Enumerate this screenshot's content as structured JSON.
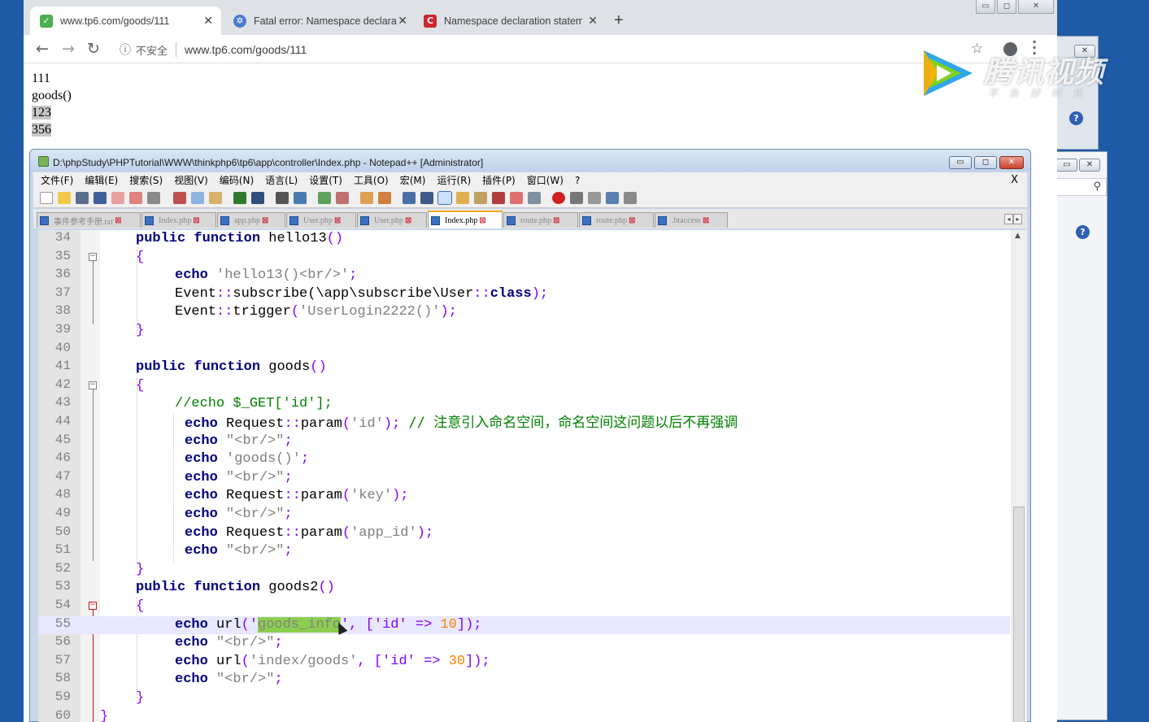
{
  "browser": {
    "tabs": [
      {
        "title": "www.tp6.com/goods/111",
        "favicon": "tp-favicon",
        "active": true
      },
      {
        "title": "Fatal error: Namespace declara",
        "favicon": "gear-favicon",
        "active": false
      },
      {
        "title": "Namespace declaration statem",
        "favicon": "c-favicon",
        "active": false
      }
    ],
    "insecure_label": "不安全",
    "url": "www.tp6.com/goods/111",
    "page_output": [
      "111",
      "goods()",
      "123",
      "356"
    ]
  },
  "watermark": {
    "brand": "腾讯视频",
    "slogan": "不负好时光"
  },
  "notepad": {
    "title": "D:\\phpStudy\\PHPTutorial\\WWW\\thinkphp6\\tp6\\app\\controller\\Index.php - Notepad++ [Administrator]",
    "menu": [
      "文件(F)",
      "编辑(E)",
      "搜索(S)",
      "视图(V)",
      "编码(N)",
      "语言(L)",
      "设置(T)",
      "工具(O)",
      "宏(M)",
      "运行(R)",
      "插件(P)",
      "窗口(W)",
      "?"
    ],
    "doc_tabs": [
      "事件参考手册.txt",
      "Index.php",
      "app.php",
      "User.php",
      "User.php",
      "Index.php",
      "route.php",
      "route.php",
      ".htaccess"
    ],
    "active_tab_index": 5,
    "lines": [
      {
        "n": "34"
      },
      {
        "n": "35"
      },
      {
        "n": "36"
      },
      {
        "n": "37"
      },
      {
        "n": "38"
      },
      {
        "n": "39"
      },
      {
        "n": "40"
      },
      {
        "n": "41"
      },
      {
        "n": "42"
      },
      {
        "n": "43"
      },
      {
        "n": "44"
      },
      {
        "n": "45"
      },
      {
        "n": "46"
      },
      {
        "n": "47"
      },
      {
        "n": "48"
      },
      {
        "n": "49"
      },
      {
        "n": "50"
      },
      {
        "n": "51"
      },
      {
        "n": "52"
      },
      {
        "n": "53"
      },
      {
        "n": "54"
      },
      {
        "n": "55"
      },
      {
        "n": "56"
      },
      {
        "n": "57"
      },
      {
        "n": "58"
      },
      {
        "n": "59"
      },
      {
        "n": "60"
      }
    ],
    "code": {
      "l34": [
        "public",
        "function",
        "hello13",
        "()"
      ],
      "l35": "{",
      "l36": [
        "echo",
        "'hello13()<br/>'",
        ";"
      ],
      "l37": [
        "Event",
        "::",
        "subscribe",
        "(\\app\\subscribe\\User",
        "::",
        "class",
        ");"
      ],
      "l38": [
        "Event",
        "::",
        "trigger",
        "(",
        "'UserLogin2222()'",
        ");"
      ],
      "l39": "}",
      "l41": [
        "public",
        "function",
        "goods",
        "()"
      ],
      "l42": "{",
      "l43": "//echo $_GET['id'];",
      "l44": [
        "echo",
        "Request",
        "::",
        "param",
        "(",
        "'id'",
        ");",
        "// 注意引入命名空间，命名空间这问题以后不再强调"
      ],
      "l45": [
        "echo",
        "\"<br/>\"",
        ";"
      ],
      "l46": [
        "echo",
        "'goods()'",
        ";"
      ],
      "l47": [
        "echo",
        "\"<br/>\"",
        ";"
      ],
      "l48": [
        "echo",
        "Request",
        "::",
        "param",
        "(",
        "'key'",
        ");"
      ],
      "l49": [
        "echo",
        "\"<br/>\"",
        ";"
      ],
      "l50": [
        "echo",
        "Request",
        "::",
        "param",
        "(",
        "'app_id'",
        ");"
      ],
      "l51": [
        "echo",
        "\"<br/>\"",
        ";"
      ],
      "l52": "}",
      "l53": [
        "public",
        "function",
        "goods2",
        "()"
      ],
      "l54": "{",
      "l55": [
        "echo",
        "url",
        "('",
        "goods_info",
        "',",
        "['id'",
        "=>",
        "10",
        "]);"
      ],
      "l56": [
        "echo",
        "\"<br/>\"",
        ";"
      ],
      "l57": [
        "echo",
        "url",
        "(",
        "'index/goods'",
        ",",
        "['id'",
        "=>",
        "30",
        "]);"
      ],
      "l58": [
        "echo",
        "\"<br/>\"",
        ";"
      ],
      "l59": "}",
      "l60": "}"
    }
  }
}
